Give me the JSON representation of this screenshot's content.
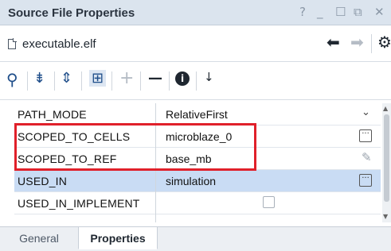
{
  "window": {
    "title": "Source File Properties",
    "controls": {
      "help": "?",
      "minimize": "_",
      "maximize": "☐",
      "restore": "⧉",
      "close": "✕"
    }
  },
  "file": {
    "name": "executable.elf",
    "icon": "file-icon"
  },
  "nav": {
    "back": "⬅",
    "forward": "➡",
    "settings": "⚙"
  },
  "toolbar": {
    "search": "⚲",
    "collapse_all": "⇟",
    "expand_all": "⇕",
    "group": "⊞",
    "add": "+",
    "remove": "—",
    "info": "i",
    "sort": "↓"
  },
  "properties": [
    {
      "name": "PATH_MODE",
      "value": "RelativeFirst",
      "control": "dropdown"
    },
    {
      "name": "SCOPED_TO_CELLS",
      "value": "microblaze_0",
      "control": "ellipsis"
    },
    {
      "name": "SCOPED_TO_REF",
      "value": "base_mb",
      "control": "pencil"
    },
    {
      "name": "USED_IN",
      "value": "simulation",
      "control": "ellipsis",
      "selected": true
    },
    {
      "name": "USED_IN_IMPLEMENT",
      "value": "",
      "control": "checkbox",
      "checked": false
    }
  ],
  "glyphs": {
    "ellipsis": "···",
    "chevron": "⌄",
    "pencil": "✎"
  },
  "tabs": [
    {
      "label": "General",
      "active": false
    },
    {
      "label": "Properties",
      "active": true
    }
  ],
  "colors": {
    "titlebar": "#dbe4ee",
    "selected_row": "#c9dcf4",
    "highlight_box": "#e0202a",
    "icon_blue": "#1f4e8a"
  }
}
